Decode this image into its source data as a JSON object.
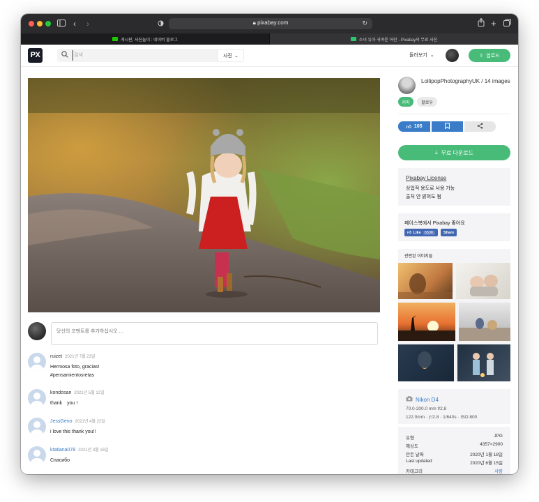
{
  "browser": {
    "url": "pixabay.com",
    "tabs": [
      {
        "label": "게시판, 사진놀이 : 네이버 블로그",
        "active": false
      },
      {
        "label": "소녀 유아 귀여운 어린 - Pixabay의 무료 사진",
        "active": true
      }
    ]
  },
  "header": {
    "logo": "PX",
    "search_placeholder": "검색",
    "search_type": "사진",
    "browse_label": "둘러보기",
    "upload_label": "업로드"
  },
  "comments": {
    "placeholder": "당신의 코멘트를 추가하십시오 ...",
    "items": [
      {
        "user": "ruizet",
        "date": "2021년 7월 23일",
        "text": "Hermosa foto, gracias!\n#pensamientosretas"
      },
      {
        "user": "kondosan",
        "date": "2021년 5월 12일",
        "text": "thank　you !"
      },
      {
        "user": "JessGeno",
        "date": "2021년 4월 22일",
        "text": "i love this thank you!!"
      },
      {
        "user": "ktatiana078",
        "date": "2021년 3월 16일",
        "text": "Спасибо"
      }
    ]
  },
  "sidebar": {
    "author": "LollipopPhotographyUK / 14 images",
    "follow_label": "커피",
    "following_label": "팔로우",
    "likes": "105",
    "download_label": "무료 다운로드",
    "license": {
      "title": "Pixabay License",
      "line1": "상업적 용도로 사용 가능",
      "line2": "출처 안 밝혀도 됨"
    },
    "facebook": {
      "title": "페이스북에서 Pixabay 좋아요",
      "like_label": "Like",
      "like_count": "653K",
      "share_label": "Share"
    },
    "related_title": "관련된 이미지들",
    "camera": {
      "name": "Nikon D4",
      "lens": "70.0-200.0 mm f/2.8",
      "settings": "122.0mm · ƒ/2.8 · 1/640s · ISO 800"
    },
    "specs": [
      {
        "label": "유형",
        "value": "JPG"
      },
      {
        "label": "해상도",
        "value": "4357×2900"
      },
      {
        "label": "만든 날짜",
        "value": "2020년 1월 18일"
      },
      {
        "label": "Last updated",
        "value": "2020년 6월 15일"
      },
      {
        "label": "카테고리",
        "value": "사람"
      }
    ]
  },
  "colors": {
    "accent_green": "#48bb78",
    "accent_blue": "#3a7cc8",
    "facebook_blue": "#4267b2"
  }
}
